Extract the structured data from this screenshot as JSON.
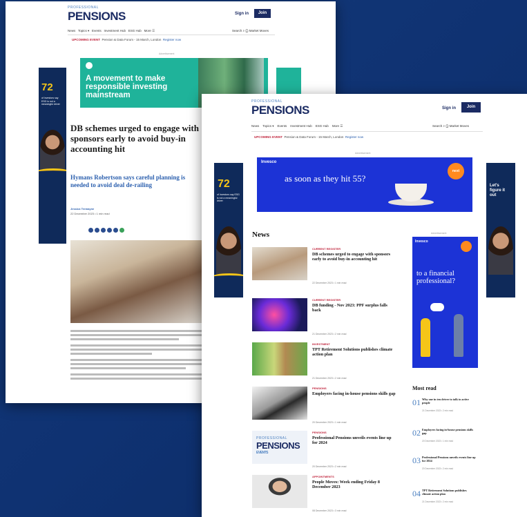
{
  "brand": {
    "pre": "PROFESSIONAL",
    "name": "PENSIONS"
  },
  "header": {
    "signin": "Sign in",
    "join": "Join"
  },
  "nav": {
    "items": [
      "News",
      "Topics ▾",
      "Events",
      "Investment Hub",
      "ESG Hub",
      "More ☰"
    ],
    "right": "Search ⌕  ⓘ Market Moves"
  },
  "upcoming": {
    "label": "UPCOMING EVENT",
    "text": "Pension & Data Forum - 15 March, London",
    "link": "Register now"
  },
  "adv_label": "Advertisement",
  "sky_ad": {
    "big": "72",
    "small": "of Investors say ESG is not a meaningful driver"
  },
  "sky_ad_right": {
    "text": "Let's figure it out"
  },
  "article": {
    "ad_banner": "A movement to make responsible investing mainstream",
    "title": "DB schemes urged to engage with sponsors early to avoid buy-in accounting hit",
    "subtitle": "Hymans Robertson says careful planning is needed to avoid deal de-railing",
    "author": "Jessica Tremayne",
    "date": "22 December 2023 • 1 min read"
  },
  "page2": {
    "ad_brand": "Invesco",
    "ad_text": "as soon as they hit 55?",
    "ad_badge": "next",
    "news_title": "News",
    "news": [
      {
        "cat": "CURRENT REGISTER",
        "title": "DB schemes urged to engage with sponsors early to avoid buy-in accounting hit",
        "meta": "22 December 2023 • 1 min read"
      },
      {
        "cat": "CURRENT REGISTER",
        "title": "DB funding - Nov 2023: PPF surplus falls back",
        "meta": "21 December 2023 • 2 min read"
      },
      {
        "cat": "INVESTMENT",
        "title": "TPT Retirement Solutions publishes climate action plan",
        "meta": "21 December 2023 • 2 min read"
      },
      {
        "cat": "PENSIONS",
        "title": "Employers facing in-house pensions skills gap",
        "meta": "20 December 2023 • 1 min read"
      },
      {
        "cat": "PENSIONS",
        "title": "Professional Pensions unveils events line up for 2024",
        "meta": "20 December 2023 • 2 min read"
      },
      {
        "cat": "APPOINTMENTS",
        "title": "People Moves: Week ending Friday 8 December 2023",
        "meta": "08 December 2023 • 3 min read"
      }
    ],
    "events_logo": {
      "pre": "PROFESSIONAL",
      "name": "PENSIONS",
      "tag": "EVENTS"
    },
    "right_ad": {
      "brand": "Invesco",
      "text": "to a financial professional?"
    },
    "most_read_title": "Most read",
    "most_read": [
      {
        "n": "01",
        "title": "Why one in ten driver to talk to active people",
        "date": "21 December 2023 • 2 min read"
      },
      {
        "n": "02",
        "title": "Employers facing in-house pensions skills gap",
        "date": "20 December 2023 • 1 min read"
      },
      {
        "n": "03",
        "title": "Professional Pensions unveils events line up for 2024",
        "date": "20 December 2023 • 2 min read"
      },
      {
        "n": "04",
        "title": "TPT Retirement Solutions publishes climate action plan",
        "date": "21 December 2023 • 2 min read"
      }
    ]
  }
}
